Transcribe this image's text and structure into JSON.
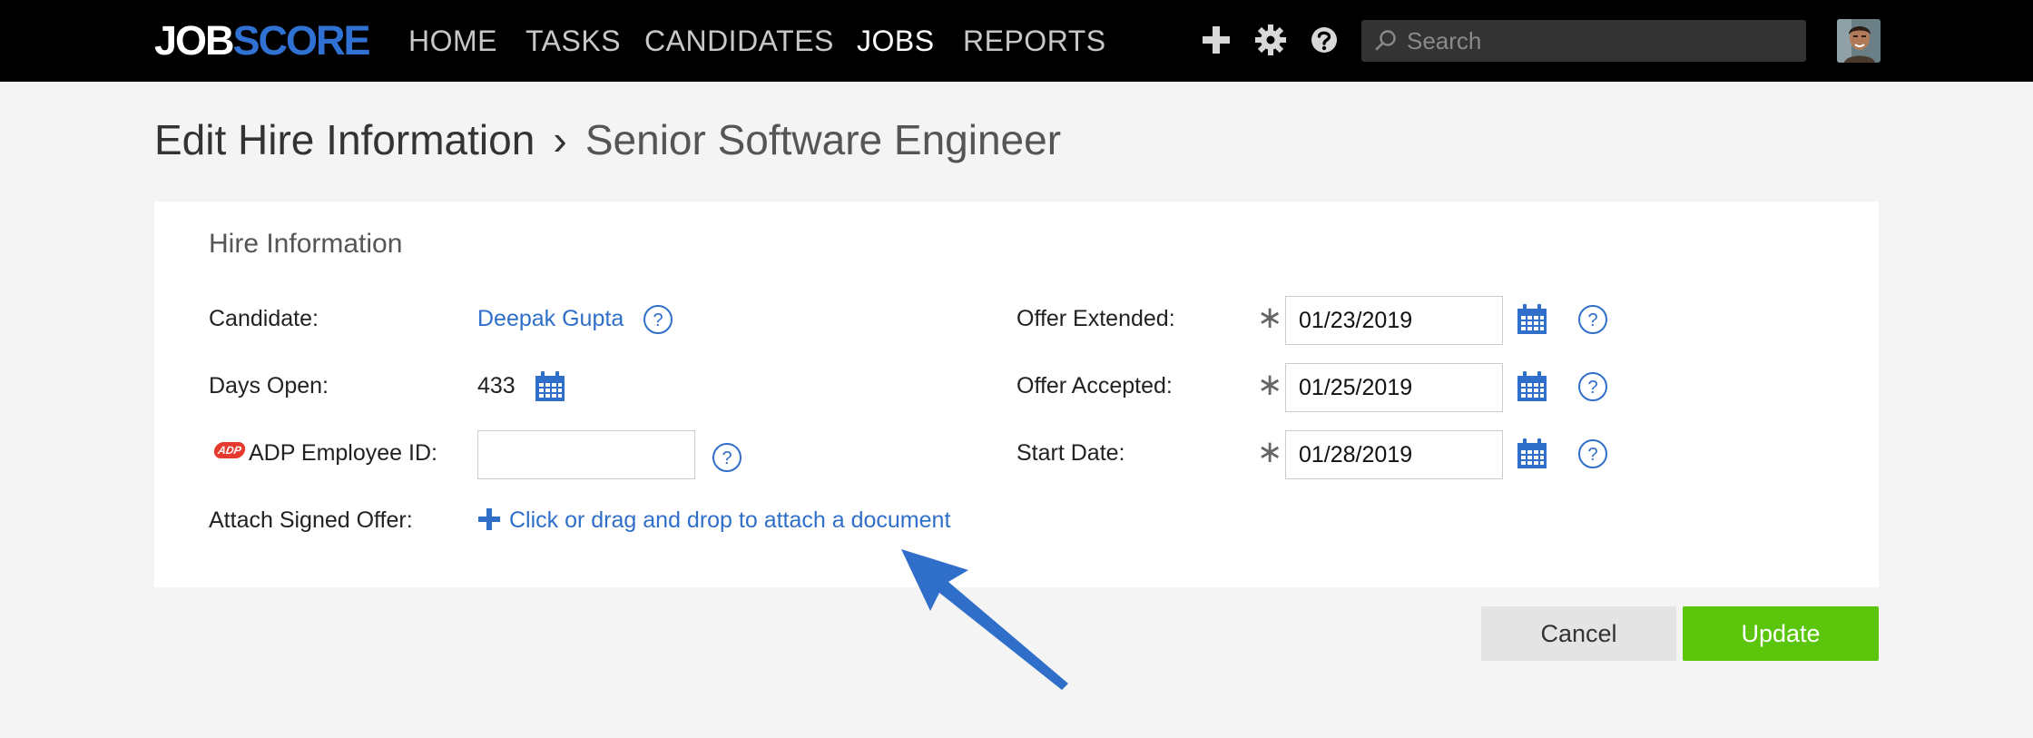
{
  "app": {
    "logo_part1": "JOB",
    "logo_part2": "SCORE"
  },
  "nav": {
    "items": [
      {
        "label": "HOME",
        "active": false
      },
      {
        "label": "TASKS",
        "active": false
      },
      {
        "label": "CANDIDATES",
        "active": false
      },
      {
        "label": "JOBS",
        "active": true
      },
      {
        "label": "REPORTS",
        "active": false
      }
    ],
    "icons": [
      "plus-icon",
      "gear-icon",
      "help-icon"
    ],
    "search_placeholder": "Search"
  },
  "page": {
    "title": "Edit Hire Information",
    "separator": "›",
    "job_name": "Senior Software Engineer"
  },
  "form": {
    "section_title": "Hire Information",
    "candidate_label": "Candidate:",
    "candidate_name": "Deepak Gupta",
    "days_open_label": "Days Open:",
    "days_open_value": "433",
    "adp_badge": "ADP",
    "adp_label": "ADP Employee ID:",
    "adp_value": "",
    "attach_label": "Attach Signed Offer:",
    "attach_text": "Click or drag and drop to attach a document",
    "offer_extended_label": "Offer Extended:",
    "offer_extended_value": "01/23/2019",
    "offer_accepted_label": "Offer Accepted:",
    "offer_accepted_value": "01/25/2019",
    "start_date_label": "Start Date:",
    "start_date_value": "01/28/2019",
    "required_marker": "∗"
  },
  "buttons": {
    "cancel": "Cancel",
    "update": "Update"
  },
  "colors": {
    "accent": "#2f72d3",
    "link": "#2f6fc9",
    "update": "#5ac50a",
    "navbar": "#000000"
  }
}
